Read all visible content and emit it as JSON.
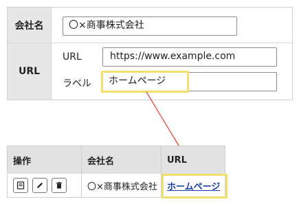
{
  "form": {
    "company": {
      "header": "会社名",
      "value": "〇×商事株式会社"
    },
    "url": {
      "header": "URL",
      "url_label": "URL",
      "url_value": "https://www.example.com",
      "label_label": "ラベル",
      "label_value": "ホームページ"
    }
  },
  "list": {
    "headers": {
      "operations": "操作",
      "company": "会社名",
      "url": "URL"
    },
    "rows": [
      {
        "company": "〇×商事株式会社",
        "url_link": "ホームページ"
      }
    ]
  },
  "colors": {
    "highlight": "#f2e06a",
    "arrow": "#e04a3a",
    "link": "#1a3fa8"
  }
}
